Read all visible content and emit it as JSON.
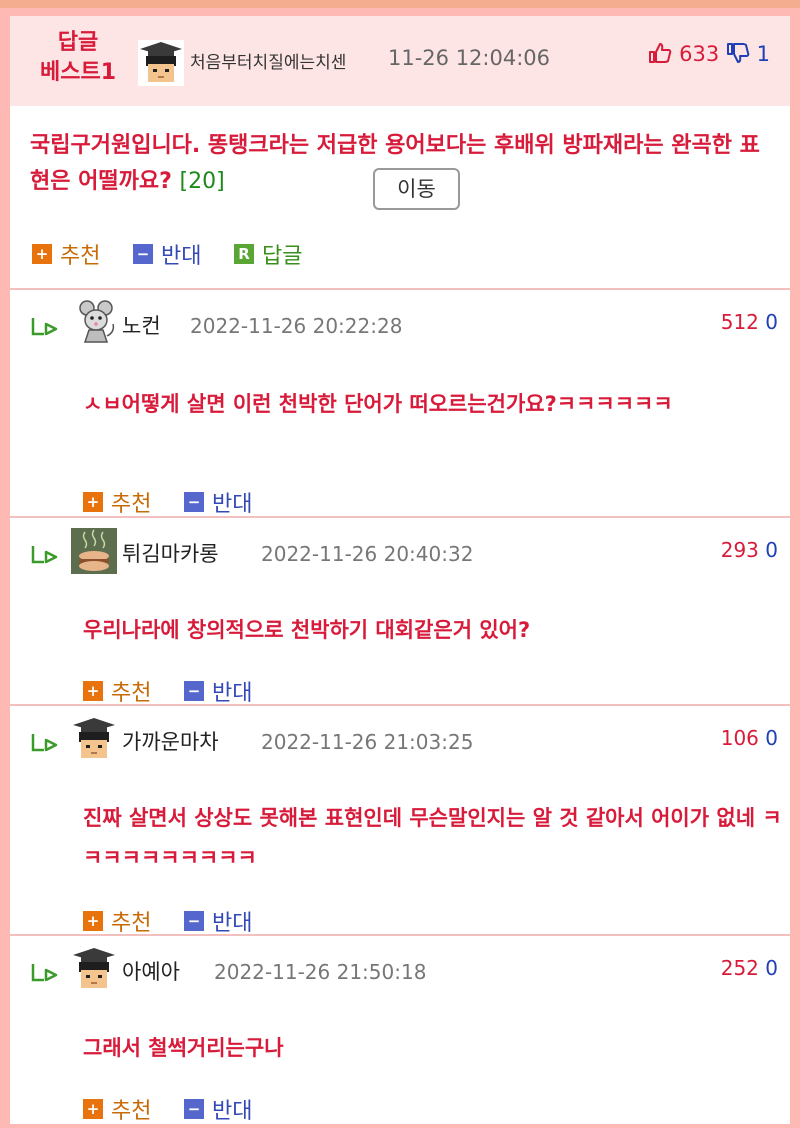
{
  "best": {
    "label": "답글\n베스트1",
    "nickname": "처음부터치질에는치센",
    "date": "11-26 12:04:06",
    "up": "633",
    "down": "1",
    "body": "국립구거원입니다. 똥탱크라는 저급한 용어보다는 후배위 방파재라는 완곡한 표현은 어떨까요?",
    "count": "[20]",
    "move_label": "이동",
    "recommend_label": "추천",
    "oppose_label": "반대",
    "reply_label": "답글"
  },
  "comments": [
    {
      "nickname": "노컨",
      "date": "2022-11-26 20:22:28",
      "up": "512",
      "down": "0",
      "text": "ㅅㅂ어떻게 살면 이런 천박한 단어가 떠오르는건가요?ㅋㅋㅋㅋㅋㅋ",
      "avatar": "mouse-avatar"
    },
    {
      "nickname": "튀김마카롱",
      "date": "2022-11-26 20:40:32",
      "up": "293",
      "down": "0",
      "text": "우리나라에 창의적으로 천박하기 대회같은거 있어?",
      "avatar": "macaron-avatar"
    },
    {
      "nickname": "가까운마차",
      "date": "2022-11-26 21:03:25",
      "up": "106",
      "down": "0",
      "text": "진짜 살면서 상상도 못해본 표현인데 무슨말인지는 알 것 같아서 어이가 없네 ㅋㅋㅋㅋㅋㅋㅋㅋㅋㅋ",
      "avatar": "graduate-avatar"
    },
    {
      "nickname": "아예아",
      "date": "2022-11-26 21:50:18",
      "up": "252",
      "down": "0",
      "text": "그래서 철썩거리는구나",
      "avatar": "graduate-avatar"
    }
  ],
  "actions": {
    "recommend": "추천",
    "oppose": "반대",
    "plus": "+",
    "minus": "−",
    "reply_badge": "R"
  },
  "colors": {
    "accent_red": "#d81b3a",
    "down_blue": "#1f3fb5",
    "header_pink": "#fde5e5",
    "frame_pink": "#ffb9b4"
  }
}
